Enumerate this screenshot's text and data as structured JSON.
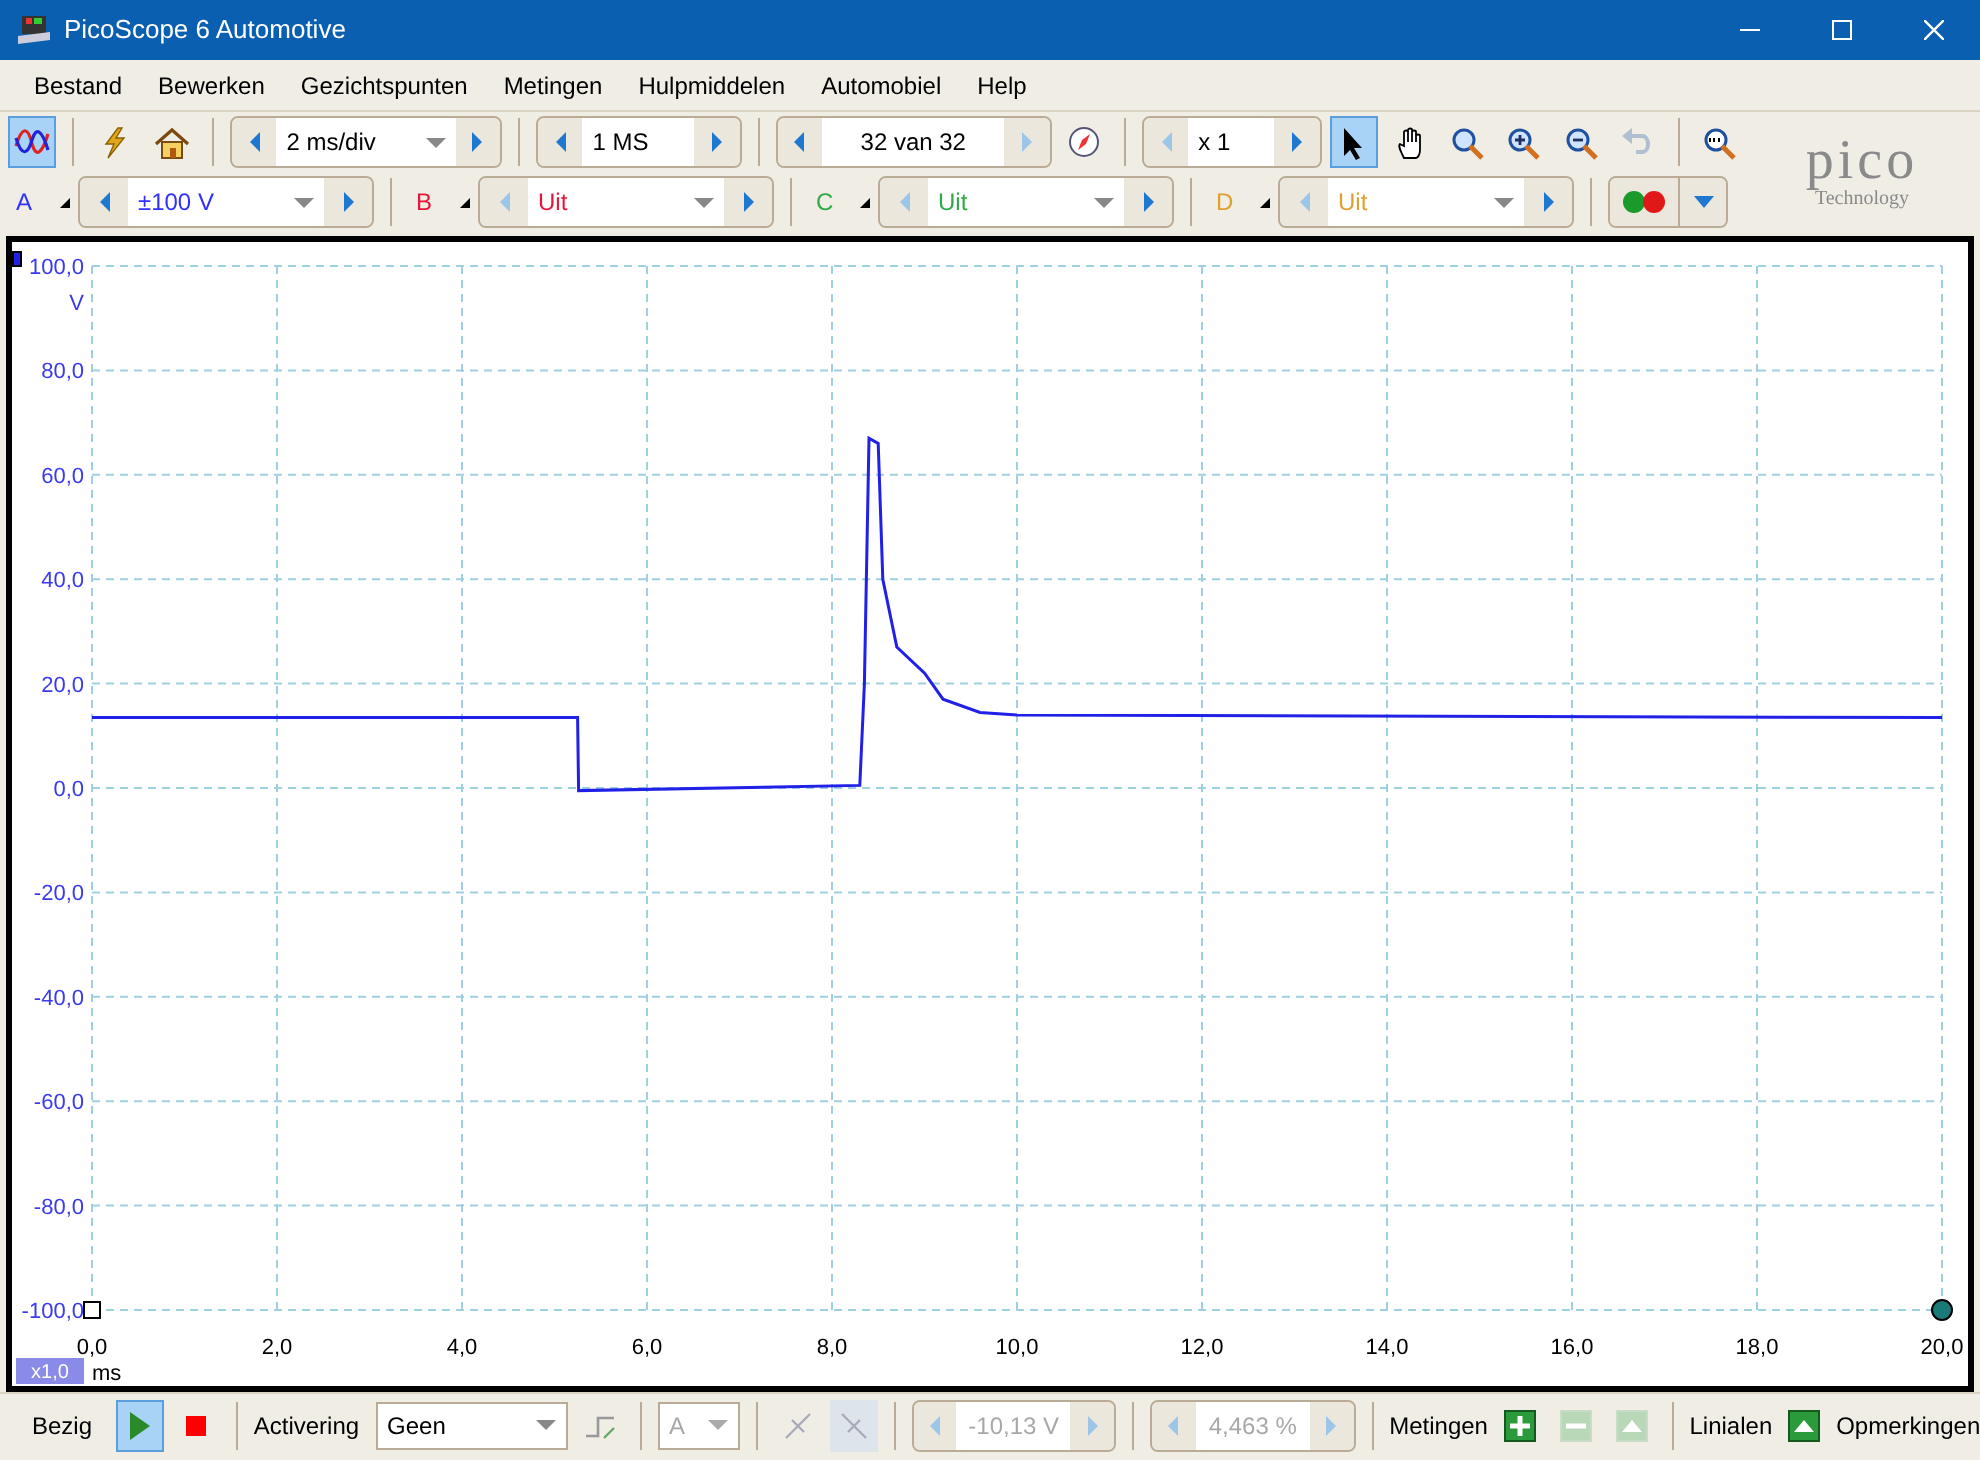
{
  "window": {
    "title": "PicoScope 6 Automotive"
  },
  "menu": [
    "Bestand",
    "Bewerken",
    "Gezichtspunten",
    "Metingen",
    "Hulpmiddelen",
    "Automobiel",
    "Help"
  ],
  "toolbar": {
    "scope_view_selected": true,
    "timebase": {
      "value": "2 ms/div"
    },
    "samples": {
      "value": "1 MS"
    },
    "buffer": {
      "value": "32 van 32"
    },
    "zoom": {
      "value": "x 1"
    },
    "tools": [
      {
        "kind": "pointer",
        "selected": true,
        "disabled": false
      },
      {
        "kind": "hand",
        "selected": false,
        "disabled": false
      },
      {
        "kind": "zoom-box",
        "selected": false,
        "disabled": false
      },
      {
        "kind": "zoom-in",
        "selected": false,
        "disabled": false
      },
      {
        "kind": "zoom-out",
        "selected": false,
        "disabled": false
      },
      {
        "kind": "undo",
        "selected": false,
        "disabled": true
      }
    ]
  },
  "logo": {
    "name": "pico",
    "tagline": "Technology"
  },
  "channels": [
    {
      "label": "A",
      "range": "±100 V",
      "color": "#3030ff",
      "on": true
    },
    {
      "label": "B",
      "range": "Uit",
      "color": "#e8173a",
      "on": false
    },
    {
      "label": "C",
      "range": "Uit",
      "color": "#2eaa48",
      "on": false
    },
    {
      "label": "D",
      "range": "Uit",
      "color": "#e0a030",
      "on": false
    }
  ],
  "plot": {
    "scale_badge": "x1,0",
    "chart_data": {
      "type": "line",
      "grid": true,
      "xlabel": "ms",
      "ylabel": "V",
      "xlim": [
        0,
        20
      ],
      "ylim": [
        -100,
        100
      ],
      "xticks": [
        {
          "value": 0,
          "label": "0,0"
        },
        {
          "value": 2,
          "label": "2,0"
        },
        {
          "value": 4,
          "label": "4,0"
        },
        {
          "value": 6,
          "label": "6,0"
        },
        {
          "value": 8,
          "label": "8,0"
        },
        {
          "value": 10,
          "label": "10,0"
        },
        {
          "value": 12,
          "label": "12,0"
        },
        {
          "value": 14,
          "label": "14,0"
        },
        {
          "value": 16,
          "label": "16,0"
        },
        {
          "value": 18,
          "label": "18,0"
        },
        {
          "value": 20,
          "label": "20,0"
        }
      ],
      "yticks": [
        {
          "value": 100,
          "label": "100,0"
        },
        {
          "value": 80,
          "label": "80,0"
        },
        {
          "value": 60,
          "label": "60,0"
        },
        {
          "value": 40,
          "label": "40,0"
        },
        {
          "value": 20,
          "label": "20,0"
        },
        {
          "value": 0,
          "label": "0,0"
        },
        {
          "value": -20,
          "label": "-20,0"
        },
        {
          "value": -40,
          "label": "-40,0"
        },
        {
          "value": -60,
          "label": "-60,0"
        },
        {
          "value": -80,
          "label": "-80,0"
        },
        {
          "value": -100,
          "label": "-100,0"
        }
      ],
      "x": [
        0,
        5.25,
        5.26,
        8.3,
        8.35,
        8.4,
        8.5,
        8.55,
        8.7,
        9.0,
        9.2,
        9.6,
        10,
        20
      ],
      "series": [
        {
          "color": "#2020e8",
          "values": [
            13.5,
            13.5,
            -0.5,
            0.5,
            20,
            67,
            66,
            40,
            27,
            22,
            17,
            14.5,
            14,
            13.5
          ]
        }
      ]
    }
  },
  "status_bar": {
    "state": "Bezig",
    "run_selected": true,
    "trigger_label": "Activering",
    "trigger_mode": "Geen",
    "trigger_channel": {
      "value": "A",
      "disabled": true
    },
    "threshold": {
      "value": "-10,13 V",
      "disabled": true
    },
    "pretrigger": {
      "value": "4,463 %",
      "disabled": true
    },
    "measurements_label": "Metingen",
    "measurement_buttons": [
      {
        "kind": "add",
        "disabled": false
      },
      {
        "kind": "remove",
        "disabled": true
      },
      {
        "kind": "edit",
        "disabled": true
      }
    ],
    "rulers_label": "Linialen",
    "notes_label": "Opmerkingen"
  }
}
